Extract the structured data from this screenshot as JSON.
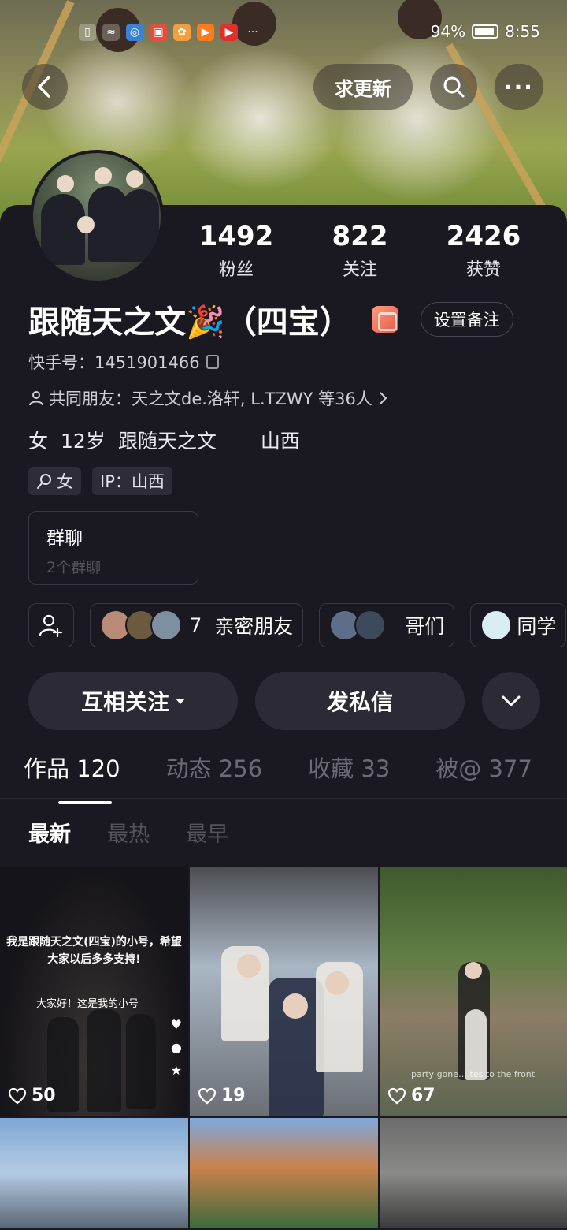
{
  "status_bar": {
    "battery": "94%",
    "time": "8:55"
  },
  "header": {
    "back_icon": "chevron-left-icon",
    "update_label": "求更新",
    "search_icon": "search-icon",
    "more_icon": "more-horizontal-icon"
  },
  "stats": [
    {
      "value": "1492",
      "label": "粉丝"
    },
    {
      "value": "822",
      "label": "关注"
    },
    {
      "value": "2426",
      "label": "获赞"
    }
  ],
  "profile": {
    "name": "跟随天之文🎉（四宝）",
    "remark_button": "设置备注",
    "id_line": "快手号：1451901466",
    "mutual_friends": "共同朋友：天之文de.洛轩, L.TZWY 等36人",
    "gender": "女",
    "age": "12岁",
    "tag_text": "跟随天之文",
    "location": "山西"
  },
  "tags": [
    {
      "icon": "search-person-icon",
      "text": "女"
    },
    {
      "text": "IP：山西"
    }
  ],
  "group": {
    "title": "群聊",
    "subtitle": "2个群聊"
  },
  "friend_chips": [
    {
      "count": "7",
      "label": "亲密朋友",
      "colors": [
        "#b98a78",
        "#6b5a40",
        "#7d8fa0"
      ]
    },
    {
      "label": "哥们",
      "colors": [
        "#5d6f88",
        "#3d4a5c"
      ]
    },
    {
      "label": "同学",
      "colors": [
        "#d9eef0"
      ]
    }
  ],
  "actions": {
    "follow": "互相关注",
    "message": "发私信"
  },
  "tabs": [
    "作品 120",
    "动态 256",
    "收藏 33",
    "被@ 377"
  ],
  "sort_options": [
    "最新",
    "最热",
    "最早"
  ],
  "videos": [
    {
      "likes": "50",
      "caption": "我是跟随天之文(四宝)的小号，希望大家以后多多支持!",
      "subtitle": "大家好！这是我的小号"
    },
    {
      "likes": "19"
    },
    {
      "likes": "67",
      "overlay_text": "party gone… tes to the front"
    },
    {},
    {},
    {}
  ]
}
